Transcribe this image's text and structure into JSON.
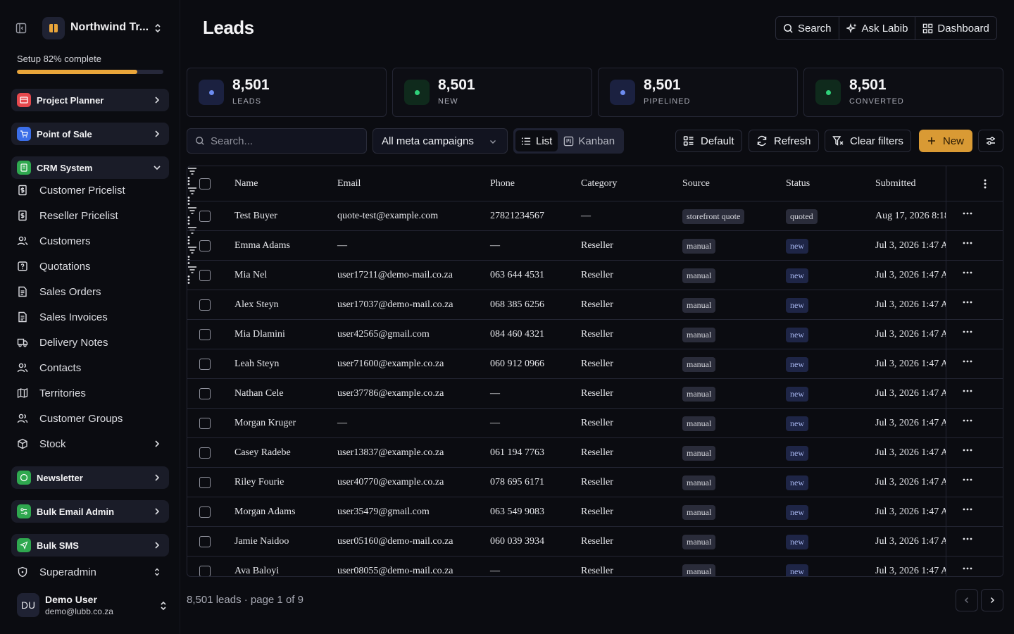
{
  "workspace": {
    "name": "Northwind Tr..."
  },
  "setup": {
    "label": "Setup 82% complete",
    "progress": 0.82
  },
  "sidebar": {
    "groups": [
      {
        "label": "Project Planner",
        "color": "#e5484d"
      },
      {
        "label": "Point of Sale",
        "color": "#3b6ee8"
      },
      {
        "label": "CRM System",
        "color": "#2fa84f"
      }
    ],
    "crm_items": [
      {
        "label": "Customer Pricelist",
        "icon": "pricelist-icon"
      },
      {
        "label": "Reseller Pricelist",
        "icon": "pricelist-icon"
      },
      {
        "label": "Customers",
        "icon": "users-icon"
      },
      {
        "label": "Quotations",
        "icon": "quote-icon"
      },
      {
        "label": "Sales Orders",
        "icon": "document-icon"
      },
      {
        "label": "Sales Invoices",
        "icon": "document-icon"
      },
      {
        "label": "Delivery Notes",
        "icon": "truck-icon"
      },
      {
        "label": "Contacts",
        "icon": "users-icon"
      },
      {
        "label": "Territories",
        "icon": "map-icon"
      },
      {
        "label": "Customer Groups",
        "icon": "users-icon"
      },
      {
        "label": "Stock",
        "icon": "box-icon"
      }
    ],
    "groups2": [
      {
        "label": "Newsletter",
        "color": "#2fa84f"
      },
      {
        "label": "Bulk Email Admin",
        "color": "#2fa84f"
      },
      {
        "label": "Bulk SMS",
        "color": "#2fa84f"
      }
    ],
    "superadmin": "Superadmin",
    "user": {
      "initials": "DU",
      "name": "Demo User",
      "email": "demo@lubb.co.za"
    }
  },
  "header": {
    "title": "Leads",
    "search": "Search",
    "ask": "Ask Labib",
    "dashboard": "Dashboard"
  },
  "stats": [
    {
      "value": "8,501",
      "label": "LEADS",
      "bg": "#1b2140",
      "dot": "#6d8cf0"
    },
    {
      "value": "8,501",
      "label": "NEW",
      "bg": "#0f2a1c",
      "dot": "#2fd27a"
    },
    {
      "value": "8,501",
      "label": "PIPELINED",
      "bg": "#1b2140",
      "dot": "#6d8cf0"
    },
    {
      "value": "8,501",
      "label": "CONVERTED",
      "bg": "#0f2a1c",
      "dot": "#2fd27a"
    }
  ],
  "toolbar": {
    "search_placeholder": "Search...",
    "campaign": "All meta campaigns",
    "list": "List",
    "kanban": "Kanban",
    "default": "Default",
    "refresh": "Refresh",
    "clear": "Clear filters",
    "new": "New"
  },
  "table": {
    "columns": [
      "Name",
      "Email",
      "Phone",
      "Category",
      "Source",
      "Status",
      "Submitted"
    ],
    "rows": [
      [
        "Test Buyer",
        "quote-test@example.com",
        "27821234567",
        "—",
        "storefront quote",
        "quoted",
        "Aug 17, 2026 8:18"
      ],
      [
        "Emma Adams",
        "—",
        "—",
        "Reseller",
        "manual",
        "new",
        "Jul 3, 2026 1:47 A"
      ],
      [
        "Mia Nel",
        "user17211@demo-mail.co.za",
        "063 644 4531",
        "Reseller",
        "manual",
        "new",
        "Jul 3, 2026 1:47 A"
      ],
      [
        "Alex Steyn",
        "user17037@demo-mail.co.za",
        "068 385 6256",
        "Reseller",
        "manual",
        "new",
        "Jul 3, 2026 1:47 A"
      ],
      [
        "Mia Dlamini",
        "user42565@gmail.com",
        "084 460 4321",
        "Reseller",
        "manual",
        "new",
        "Jul 3, 2026 1:47 A"
      ],
      [
        "Leah Steyn",
        "user71600@example.co.za",
        "060 912 0966",
        "Reseller",
        "manual",
        "new",
        "Jul 3, 2026 1:47 A"
      ],
      [
        "Nathan Cele",
        "user37786@example.co.za",
        "—",
        "Reseller",
        "manual",
        "new",
        "Jul 3, 2026 1:47 A"
      ],
      [
        "Morgan Kruger",
        "—",
        "—",
        "Reseller",
        "manual",
        "new",
        "Jul 3, 2026 1:47 A"
      ],
      [
        "Casey Radebe",
        "user13837@example.co.za",
        "061 194 7763",
        "Reseller",
        "manual",
        "new",
        "Jul 3, 2026 1:47 A"
      ],
      [
        "Riley Fourie",
        "user40770@example.co.za",
        "078 695 6171",
        "Reseller",
        "manual",
        "new",
        "Jul 3, 2026 1:47 A"
      ],
      [
        "Morgan Adams",
        "user35479@gmail.com",
        "063 549 9083",
        "Reseller",
        "manual",
        "new",
        "Jul 3, 2026 1:47 A"
      ],
      [
        "Jamie Naidoo",
        "user05160@demo-mail.co.za",
        "060 039 3934",
        "Reseller",
        "manual",
        "new",
        "Jul 3, 2026 1:47 A"
      ],
      [
        "Ava Baloyi",
        "user08055@demo-mail.co.za",
        "—",
        "Reseller",
        "manual",
        "new",
        "Jul 3, 2026 1:47 A"
      ]
    ]
  },
  "footer": {
    "summary": "8,501 leads · page 1 of 9"
  }
}
